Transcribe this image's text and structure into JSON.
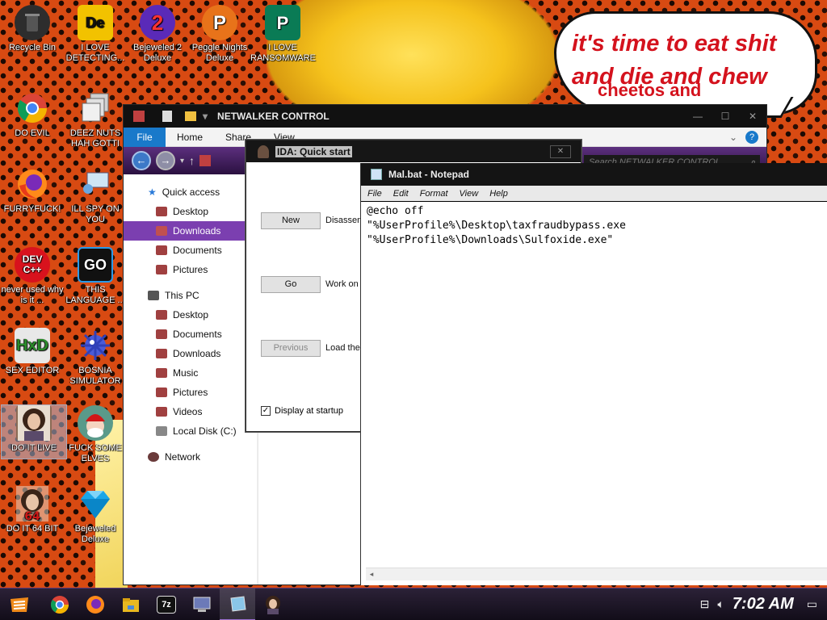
{
  "desktop": {
    "speech_bubble": {
      "line1": "it's time to eat shit",
      "line2": "and die and chew",
      "line3": "cheetos and"
    },
    "icons": [
      {
        "label": "Recycle Bin",
        "icon": "recycle-bin-icon",
        "color": "#2d2d2d"
      },
      {
        "label": "I LOVE DETECTING...",
        "icon": "die-icon",
        "color": "#f2c200"
      },
      {
        "label": "Bejeweled 2 Deluxe",
        "icon": "bejeweled-icon",
        "color": "#c8101a"
      },
      {
        "label": "Peggle Nights Deluxe",
        "icon": "peggle-icon",
        "color": "#e8731a"
      },
      {
        "label": "I LOVE RANSOMWARE",
        "icon": "publisher-icon",
        "color": "#0a7b55"
      },
      {
        "label": "DO EVIL",
        "icon": "chrome-icon",
        "color": "#3b8ae0"
      },
      {
        "label": "DEEZ NUTS HAH GOTTI",
        "icon": "windows-stack-icon",
        "color": "#cfcfcf"
      },
      {
        "label": "FURRYFUCK!",
        "icon": "firefox-icon",
        "color": "#ff6a1a"
      },
      {
        "label": "ILL SPY ON YOU",
        "icon": "remote-desktop-icon",
        "color": "#7ab4e0"
      },
      {
        "label": "never used why is it ...",
        "icon": "devcpp-icon",
        "color": "#d8121d"
      },
      {
        "label": "THIS LANGUAGE ...",
        "icon": "goland-icon",
        "color": "#1a1a1a"
      },
      {
        "label": "SEX EDITOR",
        "icon": "hxd-icon",
        "color": "#e0e0e0"
      },
      {
        "label": "BOSNIA SIMULATOR",
        "icon": "mine-icon",
        "color": "#4b5bd8"
      },
      {
        "label": "DO IT LIVE",
        "icon": "portrait-icon",
        "color": "#8a6a55"
      },
      {
        "label": "FUCK SOME ELVES",
        "icon": "santa-icon",
        "color": "#5a9a8a"
      },
      {
        "label": "DO IT 64 BIT",
        "icon": "portrait-64-icon",
        "color": "#8a6a55"
      },
      {
        "label": "Bejeweled Deluxe",
        "icon": "diamond-icon",
        "color": "#1aa6e8"
      }
    ]
  },
  "explorer": {
    "title": "NETWALKER CONTROL",
    "ribbon_tabs": [
      "File",
      "Home",
      "Share",
      "View"
    ],
    "search_placeholder": "Search NETWALKER CONTROL",
    "nav": {
      "quick_access": "Quick access",
      "quick_items": [
        "Desktop",
        "Downloads",
        "Documents",
        "Pictures"
      ],
      "this_pc": "This PC",
      "pc_items": [
        "Desktop",
        "Documents",
        "Downloads",
        "Music",
        "Pictures",
        "Videos",
        "Local Disk (C:)"
      ],
      "network": "Network"
    },
    "selected_nav": "Downloads"
  },
  "ida": {
    "title": "IDA: Quick start",
    "buttons": [
      {
        "label": "New",
        "desc": "Disassem",
        "enabled": true
      },
      {
        "label": "Go",
        "desc": "Work on",
        "enabled": true
      },
      {
        "label": "Previous",
        "desc": "Load the",
        "enabled": false
      }
    ],
    "checkbox_label": "Display at startup",
    "checkbox_checked": true
  },
  "notepad": {
    "title": "Mal.bat - Notepad",
    "menu": [
      "File",
      "Edit",
      "Format",
      "View",
      "Help"
    ],
    "content": "@echo off\n\"%UserProfile%\\Desktop\\taxfraudbypass.exe\n\"%UserProfile%\\Downloads\\Sulfoxide.exe\""
  },
  "taskbar": {
    "apps": [
      {
        "icon": "chrome-icon",
        "color": "#3b8ae0"
      },
      {
        "icon": "firefox-icon",
        "color": "#ff6a1a"
      },
      {
        "icon": "file-explorer-icon",
        "color": "#e8b820"
      },
      {
        "icon": "7zip-icon",
        "label": "7z",
        "color": "#111111"
      },
      {
        "icon": "computer-icon",
        "color": "#6c7ab8"
      },
      {
        "icon": "notepad-icon",
        "color": "#8ac6e8"
      },
      {
        "icon": "portrait-icon",
        "color": "#8a6a55"
      }
    ],
    "clock": "7:02 AM"
  }
}
